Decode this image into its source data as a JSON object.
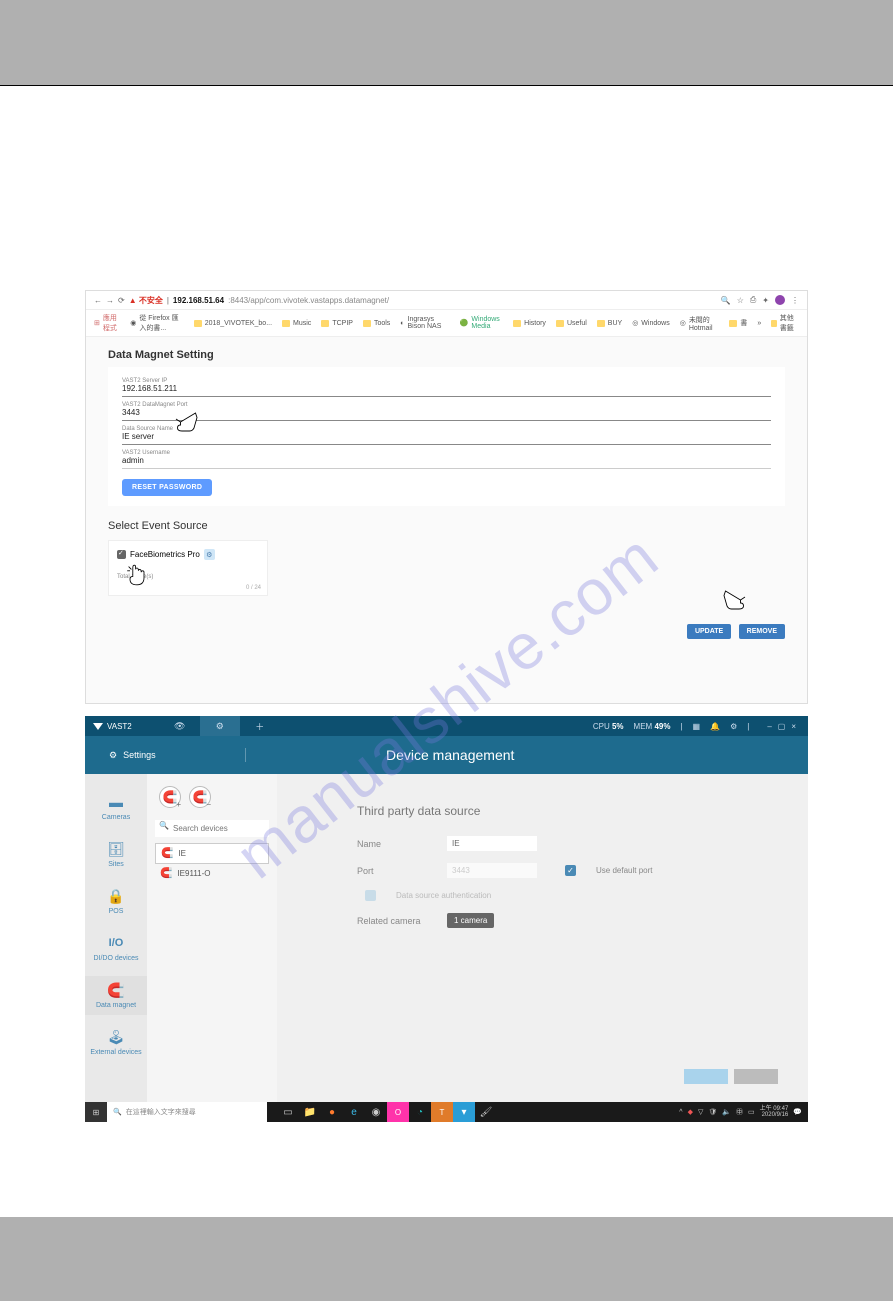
{
  "browser": {
    "security_warn": "▲ 不安全",
    "url_ip": "192.168.51.64",
    "url_rest": ":8443/app/com.vivotek.vastapps.datamagnet/",
    "bookmarks": [
      "應用程式",
      "從 Firefox 匯入的書...",
      "2018_VIVOTEK_bo...",
      "Music",
      "TCPIP",
      "Tools",
      "Ingrasys Bison NAS",
      "Windows Media",
      "History",
      "Useful",
      "BUY",
      "Windows",
      "未閱的 Hotmail",
      "書",
      "»",
      "其他書籤"
    ]
  },
  "dm": {
    "title": "Data Magnet Setting",
    "fields": {
      "server_ip": {
        "label": "VAST2 Server IP",
        "value": "192.168.51.211"
      },
      "port": {
        "label": "VAST2 DataMagnet Port",
        "value": "3443"
      },
      "name": {
        "label": "Data Source Name",
        "value": "IE server"
      },
      "user": {
        "label": "VAST2 Username",
        "value": "admin"
      }
    },
    "reset": "RESET PASSWORD",
    "select_title": "Select Event Source",
    "source_name": "FaceBiometrics Pro",
    "source_desc": "Total 1 rule(s)",
    "source_count": "0 / 24",
    "update": "UPDATE",
    "remove": "REMOVE"
  },
  "vast": {
    "brand": "VAST2",
    "cpu_lbl": "CPU",
    "cpu_val": "5%",
    "mem_lbl": "MEM",
    "mem_val": "49%",
    "settings": "Settings",
    "header_title": "Device management",
    "nav": {
      "cameras": "Cameras",
      "sites": "Sites",
      "pos": "POS",
      "io_lbl": "I/O",
      "io": "DI/DO devices",
      "dm": "Data magnet",
      "ext": "External devices"
    },
    "search_ph": "Search devices",
    "dev1": "IE",
    "dev2": "IE9111-O",
    "panel": {
      "title": "Third party data source",
      "name_lbl": "Name",
      "name_val": "IE",
      "port_lbl": "Port",
      "port_val": "3443",
      "default_port": "Use default port",
      "auth": "Data source authentication",
      "related": "Related camera",
      "camera_pill": "1 camera"
    }
  },
  "taskbar": {
    "search_ph": "在這裡輸入文字來搜尋",
    "time": "上午 09:47",
    "date": "2020/9/16"
  },
  "watermark": "manualshive.com"
}
